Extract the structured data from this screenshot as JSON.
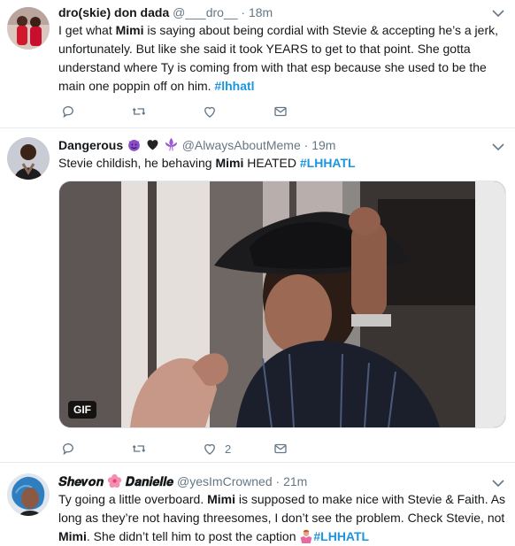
{
  "tweets": [
    {
      "name": "dro(skie) don dada",
      "handle": "@___dro__",
      "dot": "·",
      "time": "18m",
      "text_1": "I get what ",
      "bold_1": "Mimi",
      "text_2": " is saying about being cordial with Stevie & accepting he’s a jerk, unfortunately. But like she said it took YEARS to get to that point. She gotta understand where Ty is coming from with that esp because she used to be the main one poppin off on him. ",
      "hashtag": "#lhhatl"
    },
    {
      "name": "Dangerous",
      "handle": "@AlwaysAboutMeme",
      "dot": "·",
      "time": "19m",
      "text_1": "Stevie childish, he behaving ",
      "bold_1": "Mimi",
      "text_2": " HEATED ",
      "hashtag": "#LHHATL",
      "gif_label": "GIF",
      "like_count": "2"
    },
    {
      "name": "𝑺𝒉𝒆𝒗𝒐𝒏",
      "name_2": "𝑫𝒂𝒏𝒊𝒆𝒍𝒍𝒆",
      "handle": "@yesImCrowned",
      "dot": "·",
      "time": "21m",
      "text_1": "Ty going a little overboard. ",
      "bold_1": "Mimi",
      "text_2": " is supposed to make nice with Stevie & Faith. As long as they’re not having threesomes, I don’t see the problem. Check Stevie, not ",
      "bold_2": "Mimi",
      "text_3": ". She didn’t tell him to post the caption ",
      "hashtag": "#LHHATL"
    }
  ],
  "colors": {
    "link": "#1b95e0",
    "muted": "#657786",
    "border": "#e6ecf0"
  },
  "icons": [
    "reply-icon",
    "retweet-icon",
    "like-icon",
    "dm-icon",
    "caret-down-icon",
    "devil-emoji",
    "black-heart-emoji",
    "fleur-de-lis-emoji",
    "hibiscus-emoji",
    "woman-shrugging-emoji"
  ]
}
